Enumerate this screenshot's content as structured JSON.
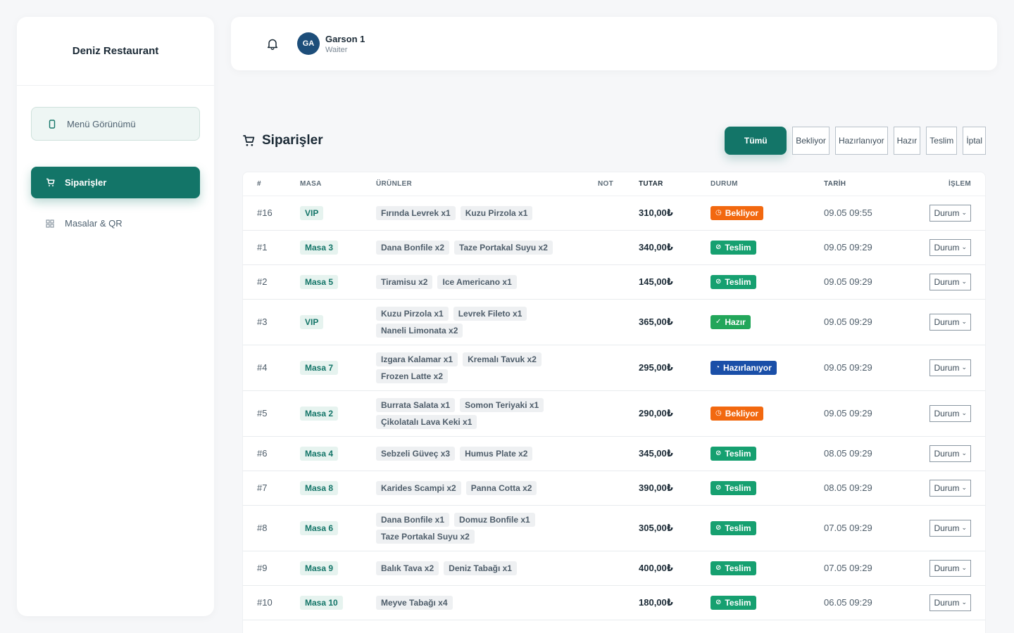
{
  "brand": "Deniz Restaurant",
  "sidebar": {
    "menu_view": "Menü Görünümü",
    "items": [
      {
        "label": "Siparişler",
        "active": true
      },
      {
        "label": "Masalar & QR",
        "active": false
      }
    ]
  },
  "user": {
    "initials": "GA",
    "name": "Garson 1",
    "role": "Waiter"
  },
  "orders": {
    "title": "Siparişler",
    "filters": [
      "Tümü",
      "Bekliyor",
      "Hazırlanıyor",
      "Hazır",
      "Teslim",
      "İptal"
    ],
    "columns": [
      "#",
      "MASA",
      "ÜRÜNLER",
      "NOT",
      "TUTAR",
      "DURUM",
      "TARİH",
      "İŞLEM"
    ],
    "action_label": "Durum",
    "rows": [
      {
        "id": "#16",
        "masa": "VIP",
        "items": [
          "Fırında Levrek x1",
          "Kuzu Pirzola x1"
        ],
        "note": "",
        "total": "310,00₺",
        "status": "Bekliyor",
        "date": "09.05 09:55"
      },
      {
        "id": "#1",
        "masa": "Masa 3",
        "items": [
          "Dana Bonfile x2",
          "Taze Portakal Suyu x2"
        ],
        "note": "",
        "total": "340,00₺",
        "status": "Teslim",
        "date": "09.05 09:29"
      },
      {
        "id": "#2",
        "masa": "Masa 5",
        "items": [
          "Tiramisu x2",
          "Ice Americano x1"
        ],
        "note": "",
        "total": "145,00₺",
        "status": "Teslim",
        "date": "09.05 09:29"
      },
      {
        "id": "#3",
        "masa": "VIP",
        "items": [
          "Kuzu Pirzola x1",
          "Levrek Fileto x1",
          "Naneli Limonata x2"
        ],
        "note": "",
        "total": "365,00₺",
        "status": "Hazır",
        "date": "09.05 09:29"
      },
      {
        "id": "#4",
        "masa": "Masa 7",
        "items": [
          "Izgara Kalamar x1",
          "Kremalı Tavuk x2",
          "Frozen Latte x2"
        ],
        "note": "",
        "total": "295,00₺",
        "status": "Hazırlanıyor",
        "date": "09.05 09:29"
      },
      {
        "id": "#5",
        "masa": "Masa 2",
        "items": [
          "Burrata Salata x1",
          "Somon Teriyaki x1",
          "Çikolatalı Lava Keki x1"
        ],
        "note": "",
        "total": "290,00₺",
        "status": "Bekliyor",
        "date": "09.05 09:29"
      },
      {
        "id": "#6",
        "masa": "Masa 4",
        "items": [
          "Sebzeli Güveç x3",
          "Humus Plate x2"
        ],
        "note": "",
        "total": "345,00₺",
        "status": "Teslim",
        "date": "08.05 09:29"
      },
      {
        "id": "#7",
        "masa": "Masa 8",
        "items": [
          "Karides Scampi x2",
          "Panna Cotta x2"
        ],
        "note": "",
        "total": "390,00₺",
        "status": "Teslim",
        "date": "08.05 09:29"
      },
      {
        "id": "#8",
        "masa": "Masa 6",
        "items": [
          "Dana Bonfile x1",
          "Domuz Bonfile x1",
          "Taze Portakal Suyu x2"
        ],
        "note": "",
        "total": "305,00₺",
        "status": "Teslim",
        "date": "07.05 09:29"
      },
      {
        "id": "#9",
        "masa": "Masa 9",
        "items": [
          "Balık Tava x2",
          "Deniz Tabağı x1"
        ],
        "note": "",
        "total": "400,00₺",
        "status": "Teslim",
        "date": "07.05 09:29"
      },
      {
        "id": "#10",
        "masa": "Masa 10",
        "items": [
          "Meyve Tabağı x4"
        ],
        "note": "",
        "total": "180,00₺",
        "status": "Teslim",
        "date": "06.05 09:29"
      }
    ]
  },
  "status_styles": {
    "Bekliyor": {
      "cls": "st-bekliyor",
      "icon": "clock-icon",
      "glyph": "◷",
      "color": "#f2680f"
    },
    "Teslim": {
      "cls": "st-teslim",
      "icon": "check-circle-icon",
      "glyph": "⊘",
      "color": "#16a070"
    },
    "Hazır": {
      "cls": "st-hazir",
      "icon": "check-icon",
      "glyph": "✓",
      "color": "#22a65a"
    },
    "Hazırlanıyor": {
      "cls": "st-hazirlaniyor",
      "icon": "timer-icon",
      "glyph": "◔",
      "color": "#1a4fa8"
    }
  },
  "colors": {
    "accent": "#137568",
    "accent_light": "#e6f3ef",
    "avatar": "#1d4e7a"
  }
}
